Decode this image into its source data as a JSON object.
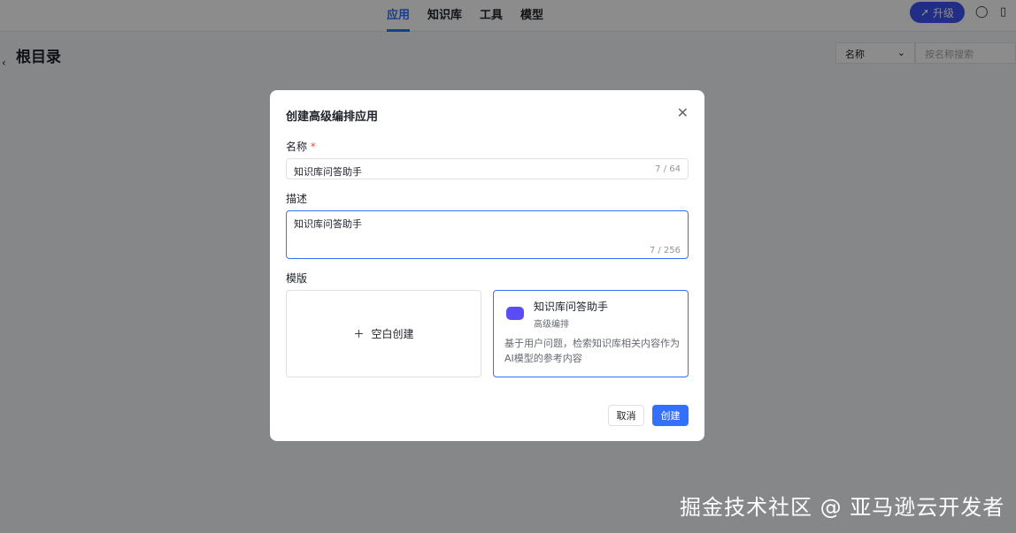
{
  "nav": {
    "tabs": [
      "应用",
      "知识库",
      "工具",
      "模型"
    ],
    "upgrade": "升级"
  },
  "page": {
    "title": "根目录",
    "sort": "名称",
    "search_placeholder": "按名称搜索"
  },
  "modal": {
    "title": "创建高级编排应用",
    "name_label": "名称",
    "name_value": "知识库问答助手",
    "name_count": "7 / 64",
    "desc_label": "描述",
    "desc_value": "知识库问答助手",
    "desc_count": "7 / 256",
    "template_label": "模版",
    "blank": "空白创建",
    "tpl_title": "知识库问答助手",
    "tpl_tag": "高级编排",
    "tpl_desc": "基于用户问题，检索知识库相关内容作为AI模型的参考内容",
    "cancel": "取消",
    "create": "创建"
  },
  "watermark": "掘金技术社区 @ 亚马逊云开发者",
  "colors": {
    "primary": "#3370ff",
    "upgrade": "#3f55f5"
  }
}
